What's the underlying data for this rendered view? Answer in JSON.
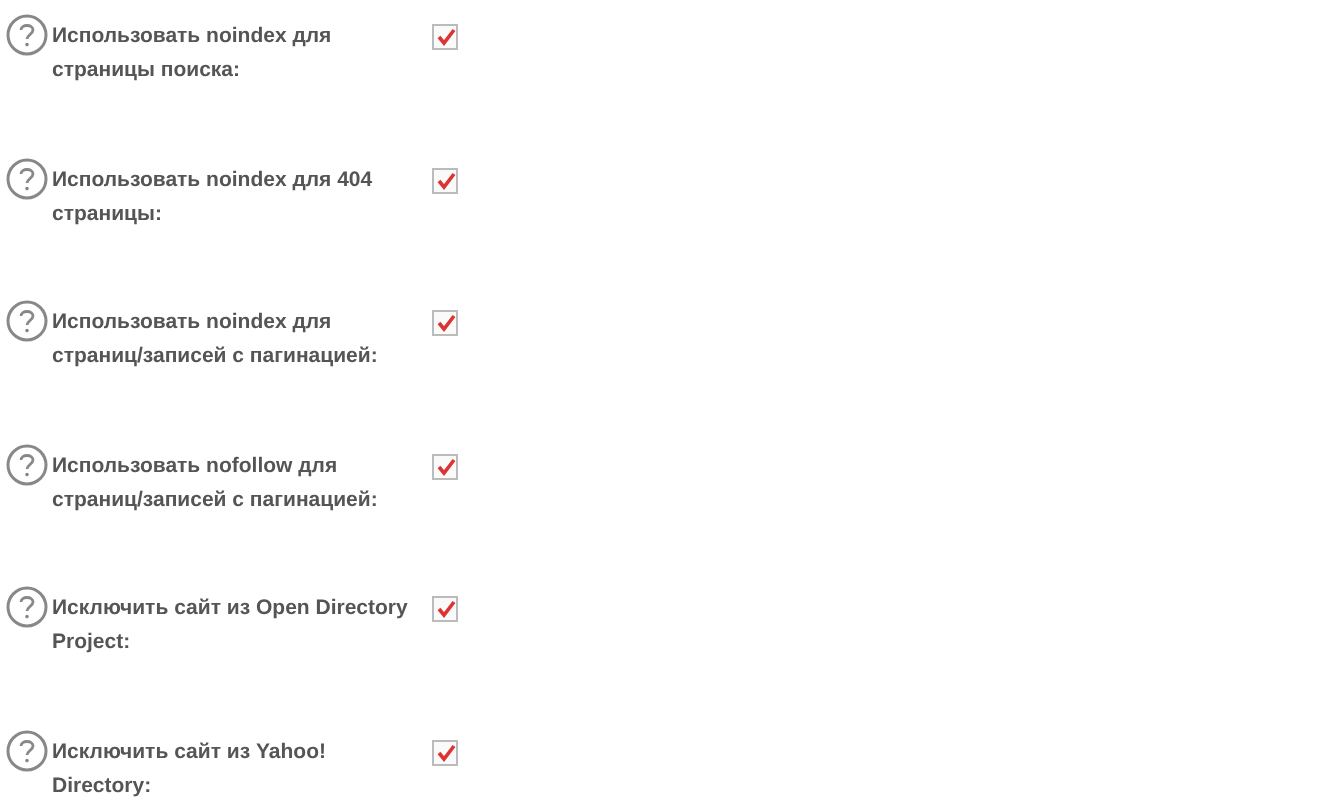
{
  "options": [
    {
      "label": "Использовать noindex для страницы поиска:",
      "checked": true
    },
    {
      "label": "Использовать noindex для 404 страницы:",
      "checked": true
    },
    {
      "label": "Использовать noindex для страниц/записей с пагинацией:",
      "checked": true
    },
    {
      "label": "Использовать nofollow для страниц/записей с пагинацией:",
      "checked": true
    },
    {
      "label": "Исключить сайт из Open Directory Project:",
      "checked": true
    },
    {
      "label": "Исключить сайт из Yahoo! Directory:",
      "checked": true
    }
  ]
}
